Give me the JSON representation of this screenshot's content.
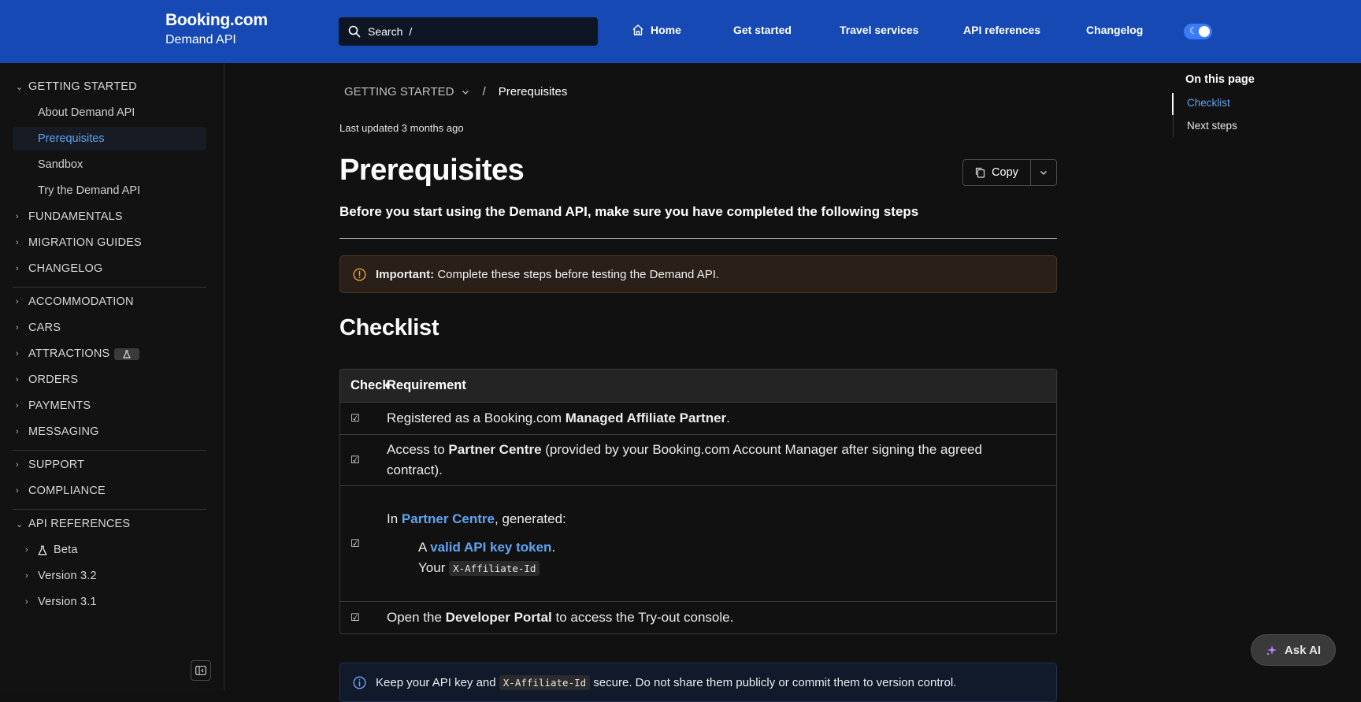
{
  "header": {
    "brand": "Booking.com",
    "brand_sub": "Demand API",
    "search_label": "Search",
    "search_shortcut": "/",
    "nav": [
      "Home",
      "Get started",
      "Travel services",
      "API references",
      "Changelog"
    ],
    "theme_toggle_icon": "☾"
  },
  "sidebar": {
    "getting_started": "GETTING STARTED",
    "gs_children": [
      "About Demand API",
      "Prerequisites",
      "Sandbox",
      "Try the Demand API"
    ],
    "group1": [
      "FUNDAMENTALS",
      "MIGRATION GUIDES",
      "CHANGELOG"
    ],
    "group2": [
      "ACCOMMODATION",
      "CARS",
      "ATTRACTIONS",
      "ORDERS",
      "PAYMENTS",
      "MESSAGING"
    ],
    "group3": [
      "SUPPORT",
      "COMPLIANCE"
    ],
    "api_references": "API REFERENCES",
    "api_children": [
      "Beta",
      "Version 3.2",
      "Version 3.1"
    ],
    "active_color": "#5ea4f2"
  },
  "breadcrumb": {
    "section": "GETTING STARTED",
    "separator": "/",
    "current": "Prerequisites"
  },
  "page": {
    "updated": "Last updated 3 months ago",
    "title": "Prerequisites",
    "copy_label": "Copy",
    "subtitle": "Before you start using the Demand API, make sure you have completed the following steps",
    "important_label": "Important:",
    "important_text": " Complete these steps before testing the Demand API.",
    "checklist_heading": "Checklist",
    "info_pre": "Keep your API key and ",
    "info_code": "X-Affiliate-Id",
    "info_post": " secure. Do not share them publicly or commit them to version control."
  },
  "table": {
    "headers": [
      "Check",
      "Requirement"
    ],
    "check_mark": "☑",
    "row1": {
      "pre": "Registered as a Booking.com ",
      "bold": "Managed Affiliate Partner",
      "post": "."
    },
    "row2": {
      "pre": "Access to ",
      "bold": "Partner Centre",
      "post": " (provided by your Booking.com Account Manager after signing the agreed contract)."
    },
    "row3": {
      "pre": "In ",
      "link": "Partner Centre",
      "post": ", generated:",
      "sub1_pre": "A ",
      "sub1_link": "valid API key token",
      "sub1_post": ".",
      "sub2_pre": "Your ",
      "sub2_code": "X-Affiliate-Id"
    },
    "row4": {
      "pre": "Open the ",
      "bold": "Developer Portal",
      "post": " to access the Try-out console."
    }
  },
  "toc": {
    "title": "On this page",
    "items": [
      "Checklist",
      "Next steps"
    ],
    "active_color": "#5ea4f2"
  },
  "ask_ai": "Ask AI"
}
